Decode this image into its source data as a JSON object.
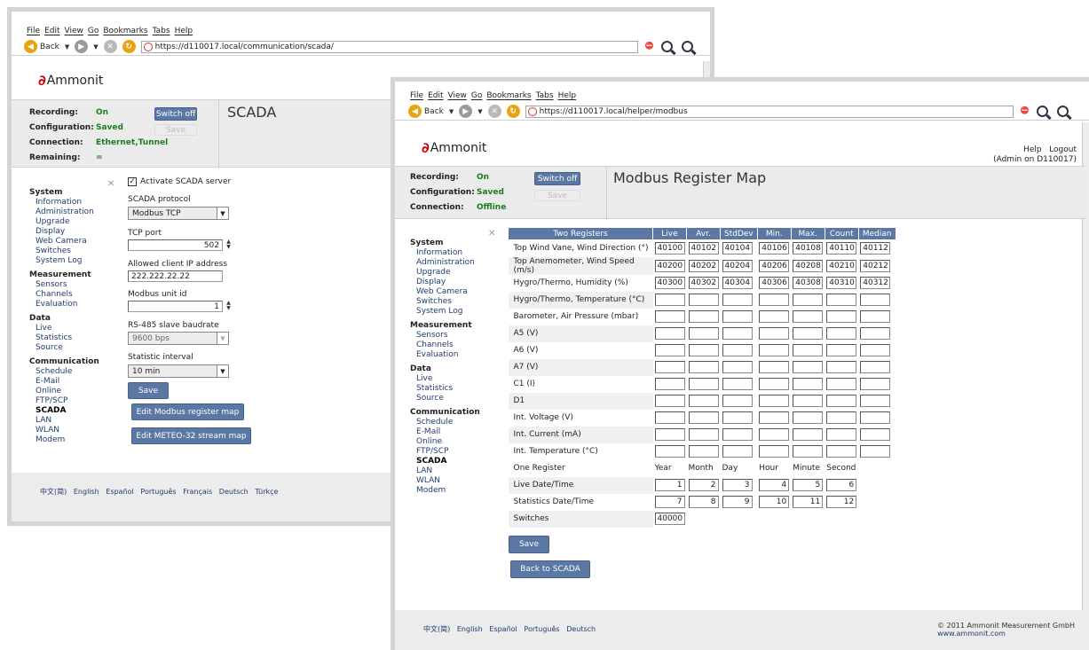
{
  "w1": {
    "menu": [
      "File",
      "Edit",
      "View",
      "Go",
      "Bookmarks",
      "Tabs",
      "Help"
    ],
    "back_label": "Back",
    "url": "https://d110017.local/communication/scada/",
    "logo": "Ammonit",
    "status": {
      "recording_label": "Recording:",
      "recording_value": "On",
      "config_label": "Configuration:",
      "config_value": "Saved",
      "connection_label": "Connection:",
      "connection_value": "Ethernet,Tunnel",
      "remaining_label": "Remaining:",
      "remaining_value": "="
    },
    "switch_off": "Switch off",
    "save_disabled": "Save",
    "title": "SCADA",
    "nav": {
      "system": "System",
      "information": "Information",
      "administration": "Administration",
      "upgrade": "Upgrade",
      "display": "Display",
      "webcam": "Web Camera",
      "switches": "Switches",
      "syslog": "System Log",
      "measurement": "Measurement",
      "sensors": "Sensors",
      "channels": "Channels",
      "evaluation": "Evaluation",
      "data": "Data",
      "live": "Live",
      "statistics": "Statistics",
      "source": "Source",
      "communication": "Communication",
      "schedule": "Schedule",
      "email": "E-Mail",
      "online": "Online",
      "ftp": "FTP/SCP",
      "scada": "SCADA",
      "lan": "LAN",
      "wlan": "WLAN",
      "modem": "Modem"
    },
    "form": {
      "activate_label": "Activate SCADA server",
      "activate_checked": true,
      "protocol_label": "SCADA protocol",
      "protocol_value": "Modbus TCP",
      "port_label": "TCP port",
      "port_value": "502",
      "ip_label": "Allowed client IP address",
      "ip_value": "222.222.22.22",
      "unit_label": "Modbus unit id",
      "unit_value": "1",
      "baud_label": "RS-485 slave baudrate",
      "baud_value": "9600 bps",
      "interval_label": "Statistic interval",
      "interval_value": "10 min",
      "save": "Save",
      "edit_modbus": "Edit Modbus register map",
      "edit_meteo": "Edit METEO-32 stream map"
    },
    "languages": "中文(简)   English   Español   Português   Français   Deutsch   Türkçe"
  },
  "w2": {
    "menu": [
      "File",
      "Edit",
      "View",
      "Go",
      "Bookmarks",
      "Tabs",
      "Help"
    ],
    "back_label": "Back",
    "url": "https://d110017.local/helper/modbus",
    "logo": "Ammonit",
    "help": "Help",
    "logout": "Logout",
    "user": "(Admin on D110017)",
    "status": {
      "recording_label": "Recording:",
      "recording_value": "On",
      "config_label": "Configuration:",
      "config_value": "Saved",
      "connection_label": "Connection:",
      "connection_value": "Offline"
    },
    "switch_off": "Switch off",
    "save_disabled": "Save",
    "title": "Modbus Register Map",
    "nav": {
      "system": "System",
      "information": "Information",
      "administration": "Administration",
      "upgrade": "Upgrade",
      "display": "Display",
      "webcam": "Web Camera",
      "switches": "Switches",
      "syslog": "System Log",
      "measurement": "Measurement",
      "sensors": "Sensors",
      "channels": "Channels",
      "evaluation": "Evaluation",
      "data": "Data",
      "live": "Live",
      "statistics": "Statistics",
      "source": "Source",
      "communication": "Communication",
      "schedule": "Schedule",
      "email": "E-Mail",
      "online": "Online",
      "ftp": "FTP/SCP",
      "scada": "SCADA",
      "lan": "LAN",
      "wlan": "WLAN",
      "modem": "Modem"
    },
    "headers": [
      "Two Registers",
      "Live",
      "Avr.",
      "StdDev",
      "Min.",
      "Max.",
      "Count",
      "Median"
    ],
    "rows": [
      {
        "label": "Top Wind Vane, Wind Direction (°)",
        "values": [
          "40100",
          "40102",
          "40104",
          "40106",
          "40108",
          "40110",
          "40112"
        ]
      },
      {
        "label": "Top Anemometer, Wind Speed (m/s)",
        "values": [
          "40200",
          "40202",
          "40204",
          "40206",
          "40208",
          "40210",
          "40212"
        ]
      },
      {
        "label": "Hygro/Thermo, Humidity (%)",
        "values": [
          "40300",
          "40302",
          "40304",
          "40306",
          "40308",
          "40310",
          "40312"
        ]
      },
      {
        "label": "Hygro/Thermo, Temperature (°C)",
        "values": [
          "",
          "",
          "",
          "",
          "",
          "",
          ""
        ]
      },
      {
        "label": "Barometer, Air Pressure (mbar)",
        "values": [
          "",
          "",
          "",
          "",
          "",
          "",
          ""
        ]
      },
      {
        "label": "A5 (V)",
        "values": [
          "",
          "",
          "",
          "",
          "",
          "",
          ""
        ]
      },
      {
        "label": "A6 (V)",
        "values": [
          "",
          "",
          "",
          "",
          "",
          "",
          ""
        ]
      },
      {
        "label": "A7 (V)",
        "values": [
          "",
          "",
          "",
          "",
          "",
          "",
          ""
        ]
      },
      {
        "label": "C1 (I)",
        "values": [
          "",
          "",
          "",
          "",
          "",
          "",
          ""
        ]
      },
      {
        "label": "D1",
        "values": [
          "",
          "",
          "",
          "",
          "",
          "",
          ""
        ]
      },
      {
        "label": "Int. Voltage (V)",
        "values": [
          "",
          "",
          "",
          "",
          "",
          "",
          ""
        ]
      },
      {
        "label": "Int. Current (mA)",
        "values": [
          "",
          "",
          "",
          "",
          "",
          "",
          ""
        ]
      },
      {
        "label": "Int. Temperature (°C)",
        "values": [
          "",
          "",
          "",
          "",
          "",
          "",
          ""
        ]
      }
    ],
    "one_register": {
      "label": "One Register",
      "headers": [
        "Year",
        "Month",
        "Day",
        "Hour",
        "Minute",
        "Second"
      ]
    },
    "date_rows": [
      {
        "label": "Live Date/Time",
        "values": [
          "1",
          "2",
          "3",
          "4",
          "5",
          "6"
        ]
      },
      {
        "label": "Statistics Date/Time",
        "values": [
          "7",
          "8",
          "9",
          "10",
          "11",
          "12"
        ]
      }
    ],
    "switches": {
      "label": "Switches",
      "value": "40000"
    },
    "save": "Save",
    "back_scada": "Back to SCADA",
    "languages": "中文(简)   English   Español   Português   Deutsch",
    "copyright": "© 2011 Ammonit Measurement GmbH",
    "website": "www.ammonit.com"
  }
}
